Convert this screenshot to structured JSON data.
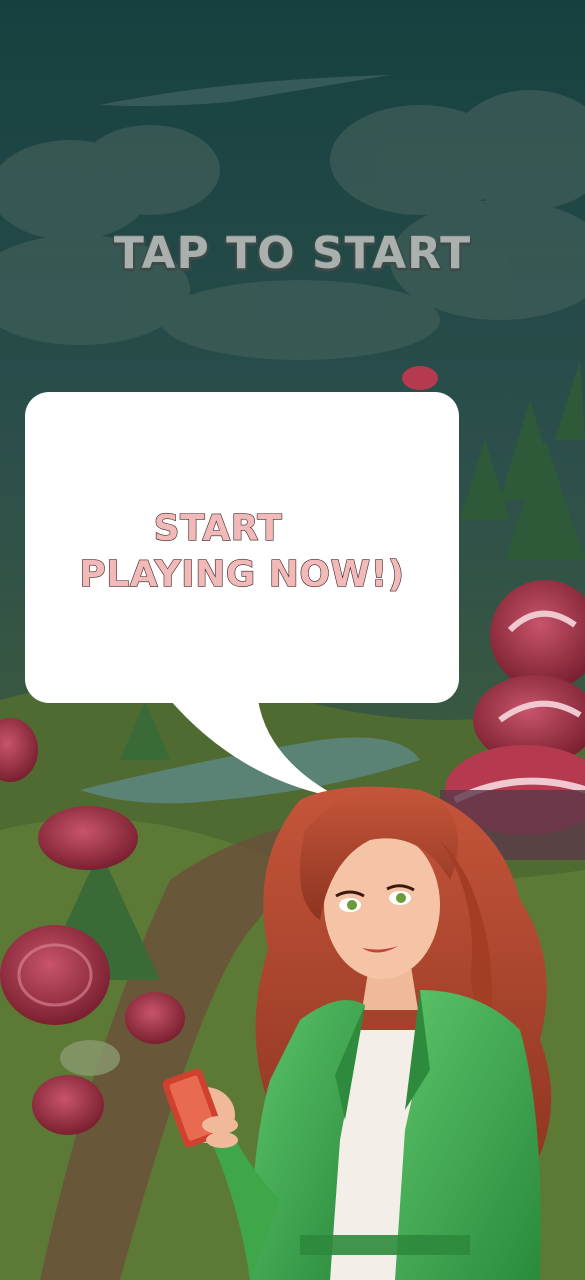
{
  "screen": {
    "tap_to_start": "TAP TO START",
    "speech_bubble": {
      "line1": "START",
      "line2": "PLAYING NOW!)"
    }
  },
  "colors": {
    "tap_text": "#a9b0ae",
    "bubble_text": "#f2b9b9",
    "bubble_bg": "#ffffff",
    "jacket": "#3fa64a",
    "hair": "#b44a2c"
  },
  "icons": {
    "character": "redhead-woman-green-jacket",
    "phone": "smartphone-icon"
  }
}
